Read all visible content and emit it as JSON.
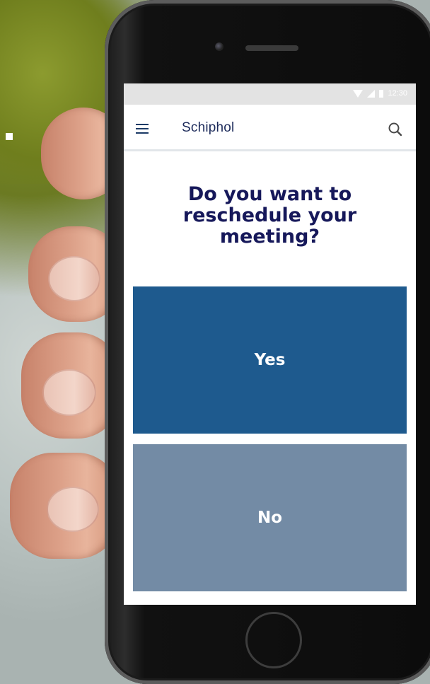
{
  "app": {
    "title": "Schiphol"
  },
  "status_bar": {
    "time": "12:30"
  },
  "prompt": {
    "question_line1": "Do you want to",
    "question_line2": "reschedule your",
    "question_line3": "meeting?"
  },
  "choices": {
    "yes_label": "Yes",
    "no_label": "No"
  },
  "colors": {
    "yes_button": "#1e5a8e",
    "no_button": "#738ba5",
    "question_text": "#16185a",
    "title_text": "#1c2a5a"
  },
  "icons": {
    "menu": "hamburger-menu-icon",
    "search": "search-icon"
  }
}
